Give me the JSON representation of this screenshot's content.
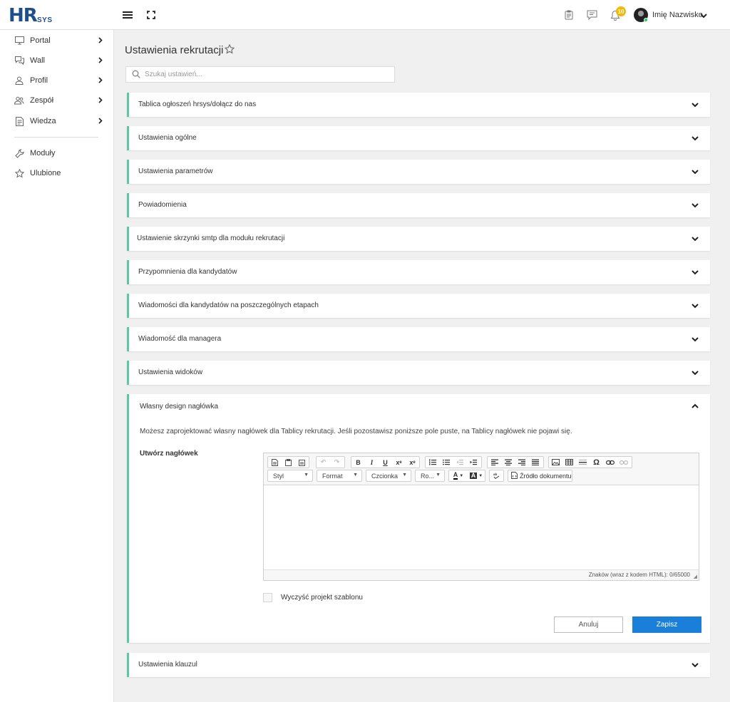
{
  "brand": {
    "logo_letters": "HR",
    "logo_suffix": "SYS"
  },
  "header": {
    "notifications_count": "10",
    "user_name": "Imię Nazwisko"
  },
  "sidebar": {
    "items": [
      {
        "label": "Portal",
        "icon": "monitor-icon",
        "has_submenu": true
      },
      {
        "label": "Wall",
        "icon": "chat-bubbles-icon",
        "has_submenu": true
      },
      {
        "label": "Profil",
        "icon": "user-icon",
        "has_submenu": true
      },
      {
        "label": "Zespół",
        "icon": "team-icon",
        "has_submenu": true
      },
      {
        "label": "Wiedza",
        "icon": "document-icon",
        "has_submenu": true
      }
    ],
    "bottom_items": [
      {
        "label": "Moduły",
        "icon": "wrench-icon"
      },
      {
        "label": "Ulubione",
        "icon": "star-icon"
      }
    ]
  },
  "page": {
    "title": "Ustawienia rekrutacji",
    "search_placeholder": "Szukaj ustawień..."
  },
  "sections": [
    "Tablica ogłoszeń hrsys/dołącz do nas",
    "Ustawienia ogólne",
    "Ustawienia parametrów",
    "Powiadomienia",
    "Ustawienie skrzynki smtp dla modułu rekrutacji",
    "Przypomnienia dla kandydatów",
    "Wiadomości dla kandydatów na poszczególnych etapach",
    "Wiadomość dla managera",
    "Ustawienia widoków"
  ],
  "open_section": {
    "title": "Własny design nagłówka",
    "description": "Możesz zaprojektować własny nagłówek dla Tablicy rekrutacji. Jeśli pozostawisz poniższe pole puste, na Tablicy nagłówek nie pojawi się.",
    "field_label": "Utwórz nagłówek",
    "editor": {
      "combo_style": "Styl",
      "combo_format": "Format",
      "combo_font": "Czcionka",
      "combo_size": "Ro...",
      "source_button": "Źródło dokumentu",
      "char_counter": "Znaków (wraz z kodem HTML): 0/65000"
    },
    "checkbox_label": "Wyczyść projekt szablonu",
    "checkbox_checked": false,
    "cancel_label": "Anuluj",
    "save_label": "Zapisz"
  },
  "last_section": "Ustawienia klauzul",
  "colors": {
    "accent": "#5cc7a1",
    "primary_button": "#1a7fd8",
    "badge": "#f5b800",
    "logo": "#1f4e8c"
  }
}
